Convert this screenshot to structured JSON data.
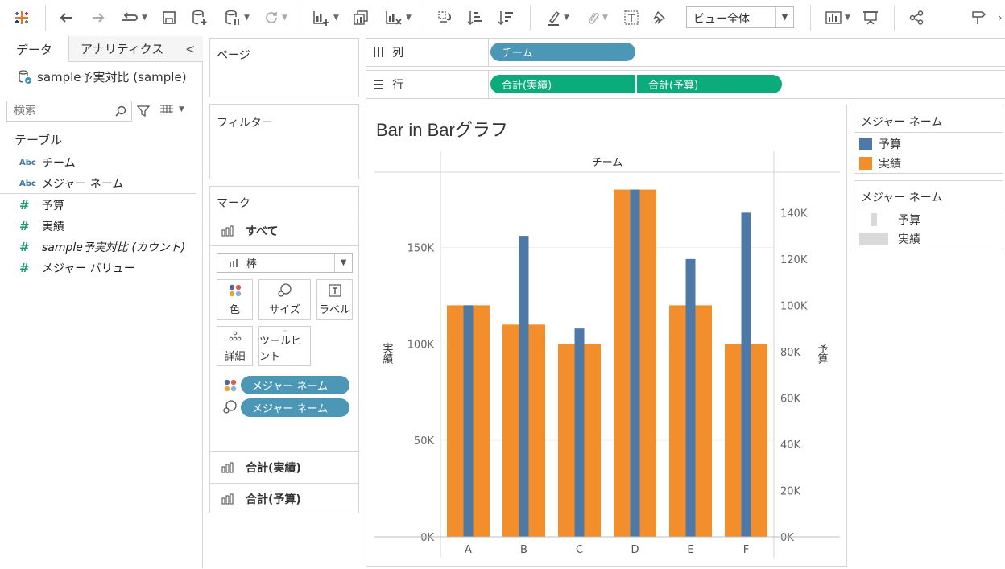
{
  "toolbar": {
    "view_select": "ビュー全体"
  },
  "datapane": {
    "tab_data": "データ",
    "tab_analytics": "アナリティクス",
    "collapse": "<",
    "datasource": "sample予実対比 (sample)",
    "search_placeholder": "検索",
    "section_table": "テーブル",
    "dimensions": [
      {
        "type": "Abc",
        "name": "チーム"
      },
      {
        "type": "Abc",
        "name": "メジャー ネーム"
      }
    ],
    "measures": [
      {
        "type": "#",
        "name": "予算"
      },
      {
        "type": "#",
        "name": "実績"
      },
      {
        "type": "#",
        "name": "sample予実対比 (カウント)"
      },
      {
        "type": "#",
        "name": "メジャー バリュー"
      }
    ]
  },
  "shelves": {
    "pages": "ページ",
    "filters": "フィルター",
    "columns_label": "列",
    "rows_label": "行",
    "columns_pills": [
      "チーム"
    ],
    "rows_pills": [
      "合計(実績)",
      "合計(予算)"
    ]
  },
  "marks": {
    "title": "マーク",
    "all": "すべて",
    "mark_type": "棒",
    "buttons": [
      "色",
      "サイズ",
      "ラベル",
      "詳細",
      "ツールヒント"
    ],
    "pills": [
      "メジャー ネーム",
      "メジャー ネーム"
    ],
    "measure_cards": [
      "合計(実績)",
      "合計(予算)"
    ]
  },
  "legend_color": {
    "title": "メジャー ネーム",
    "items": [
      {
        "label": "予算",
        "color": "#4e79a7"
      },
      {
        "label": "実績",
        "color": "#f28e2b"
      }
    ]
  },
  "legend_size": {
    "title": "メジャー ネーム",
    "items": [
      {
        "label": "予算"
      },
      {
        "label": "実績"
      }
    ]
  },
  "chart_data": {
    "type": "bar",
    "title": "Bar in Barグラフ",
    "column_header": "チーム",
    "categories": [
      "A",
      "B",
      "C",
      "D",
      "E",
      "F"
    ],
    "series": [
      {
        "name": "実績",
        "axis": "left",
        "color": "#f28e2b",
        "values": [
          120000,
          110000,
          100000,
          180000,
          120000,
          100000
        ]
      },
      {
        "name": "予算",
        "axis": "right",
        "color": "#4e79a7",
        "values": [
          100000,
          130000,
          90000,
          150000,
          120000,
          140000
        ]
      }
    ],
    "ylabel_left": "実績",
    "ylabel_right": "予算",
    "ylim_left": [
      0,
      189000
    ],
    "ylim_right": [
      0,
      157500
    ],
    "yticks_left": [
      "0K",
      "50K",
      "100K",
      "150K"
    ],
    "yticks_right": [
      "0K",
      "20K",
      "40K",
      "60K",
      "80K",
      "100K",
      "120K",
      "140K"
    ],
    "grid": true
  }
}
